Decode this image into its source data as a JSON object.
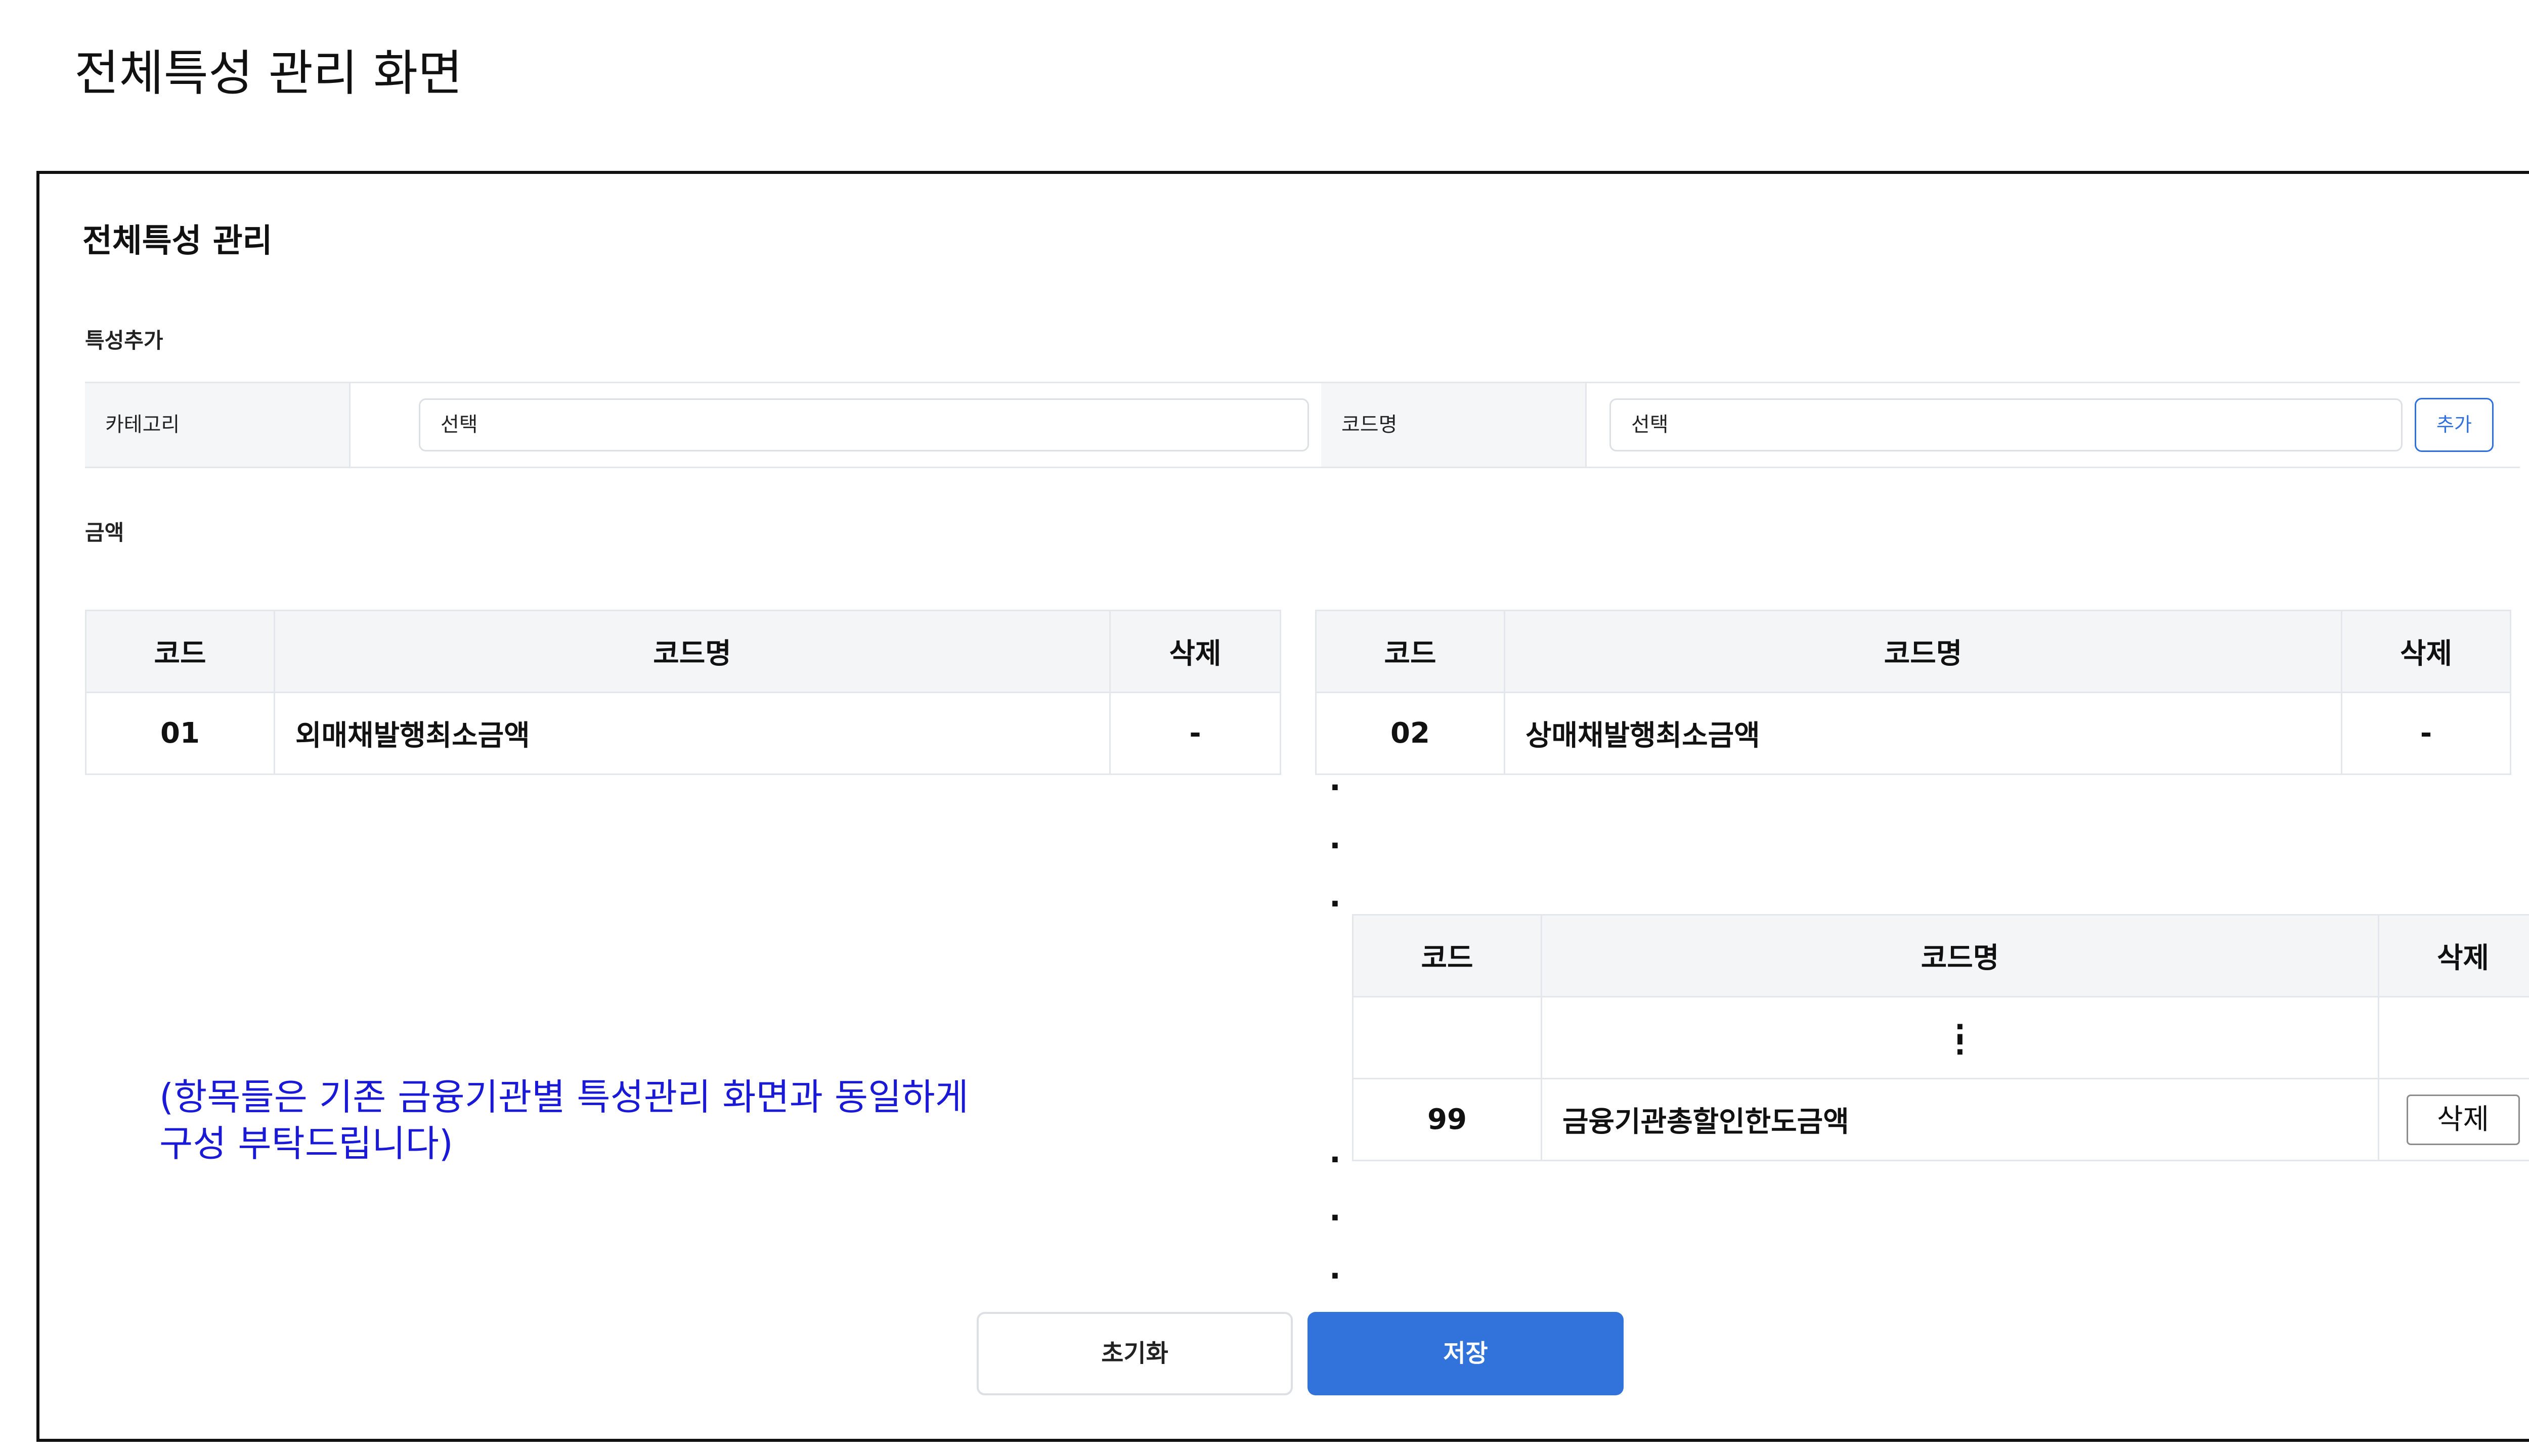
{
  "page_heading": "전체특성 관리 화면",
  "panel": {
    "title": "전체특성 관리",
    "add_section_label": "특성추가",
    "amount_section_label": "금액"
  },
  "form": {
    "category_label": "카테고리",
    "category_value": "선택",
    "codename_label": "코드명",
    "codename_value": "선택",
    "add_button": "추가"
  },
  "table_headers": {
    "code": "코드",
    "codename": "코드명",
    "delete": "삭제"
  },
  "tables": [
    {
      "code": "01",
      "name": "외매채발행최소금액",
      "delete": "-"
    },
    {
      "code": "02",
      "name": "상매채발행최소금액",
      "delete": "-"
    }
  ],
  "table3": {
    "ellipsis": ":",
    "row": {
      "code": "99",
      "name": "금융기관총할인한도금액",
      "delete_button": "삭제"
    }
  },
  "note": {
    "line1": "(항목들은 기존 금융기관별 특성관리 화면과 동일하게",
    "line2": "구성 부탁드립니다)"
  },
  "buttons": {
    "reset": "초기화",
    "save": "저장"
  },
  "colors": {
    "accent": "#3272db",
    "note_text": "#1a1ad6",
    "header_bg": "#f4f5f7"
  }
}
